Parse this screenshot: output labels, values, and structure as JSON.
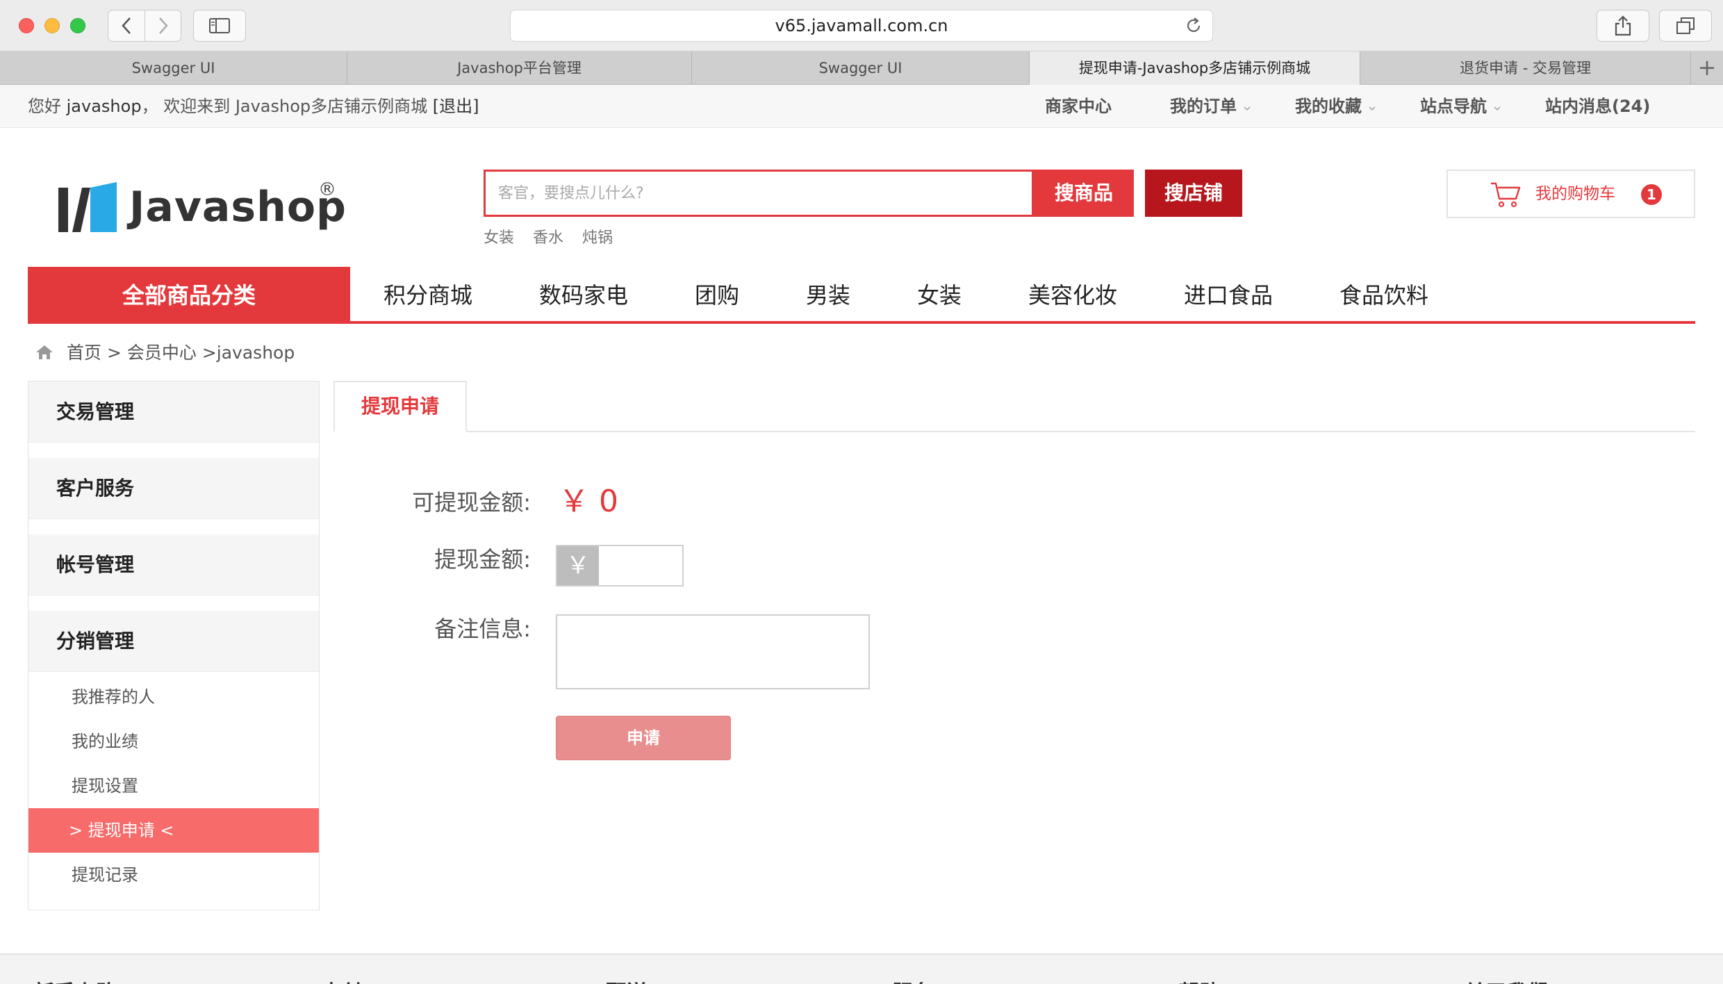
{
  "browser": {
    "url": "v65.javamall.com.cn",
    "tabs": [
      {
        "label": "Swagger UI",
        "active": false
      },
      {
        "label": "Javashop平台管理",
        "active": false
      },
      {
        "label": "Swagger UI",
        "active": false
      },
      {
        "label": "提现申请-Javashop多店铺示例商城",
        "active": true
      },
      {
        "label": "退货申请 - 交易管理",
        "active": false
      }
    ],
    "new_tab": "+"
  },
  "topbar": {
    "greeting": "您好",
    "username": "javashop",
    "welcome": "， 欢迎来到 Javashop多店铺示例商城",
    "logout": "[退出]",
    "links": [
      {
        "label": "商家中心",
        "dropdown": false
      },
      {
        "label": "我的订单",
        "dropdown": true
      },
      {
        "label": "我的收藏",
        "dropdown": true
      },
      {
        "label": "站点导航",
        "dropdown": true
      },
      {
        "label": "站内消息(24)",
        "dropdown": false
      }
    ]
  },
  "header": {
    "logo_text": "Javashop",
    "logo_reg": "®",
    "search_placeholder": "客官，要搜点儿什么?",
    "search_goods_btn": "搜商品",
    "search_shop_btn": "搜店铺",
    "hot_words": [
      "女装",
      "香水",
      "炖锅"
    ],
    "cart_label": "我的购物车",
    "cart_count": "1"
  },
  "category_nav": {
    "all_label": "全部商品分类",
    "items": [
      "积分商城",
      "数码家电",
      "团购",
      "男装",
      "女装",
      "美容化妆",
      "进口食品",
      "食品饮料"
    ]
  },
  "breadcrumb": {
    "home": "首页",
    "sep": ">",
    "member": "会员中心",
    "user": ">javashop"
  },
  "sidebar": {
    "groups": [
      "交易管理",
      "客户服务",
      "帐号管理",
      "分销管理"
    ],
    "items": [
      {
        "label": "我推荐的人",
        "active": false
      },
      {
        "label": "我的业绩",
        "active": false
      },
      {
        "label": "提现设置",
        "active": false
      },
      {
        "label": "> 提现申请 <",
        "active": true
      },
      {
        "label": "提现记录",
        "active": false
      }
    ]
  },
  "content": {
    "tab_label": "提现申请",
    "available_label": "可提现金额:",
    "available_value": "￥ 0",
    "amount_label": "提现金额:",
    "currency_symbol": "￥",
    "remark_label": "备注信息:",
    "submit_label": "申请"
  },
  "footer": {
    "columns": [
      "新手上路",
      "支付",
      "配送",
      "服务",
      "帮助",
      "关于我们"
    ]
  },
  "colors": {
    "accent": "#e4393c",
    "accent_dark": "#b7161c",
    "sidebar_active": "#f76b6b",
    "button_disabled": "#e88e8e"
  }
}
